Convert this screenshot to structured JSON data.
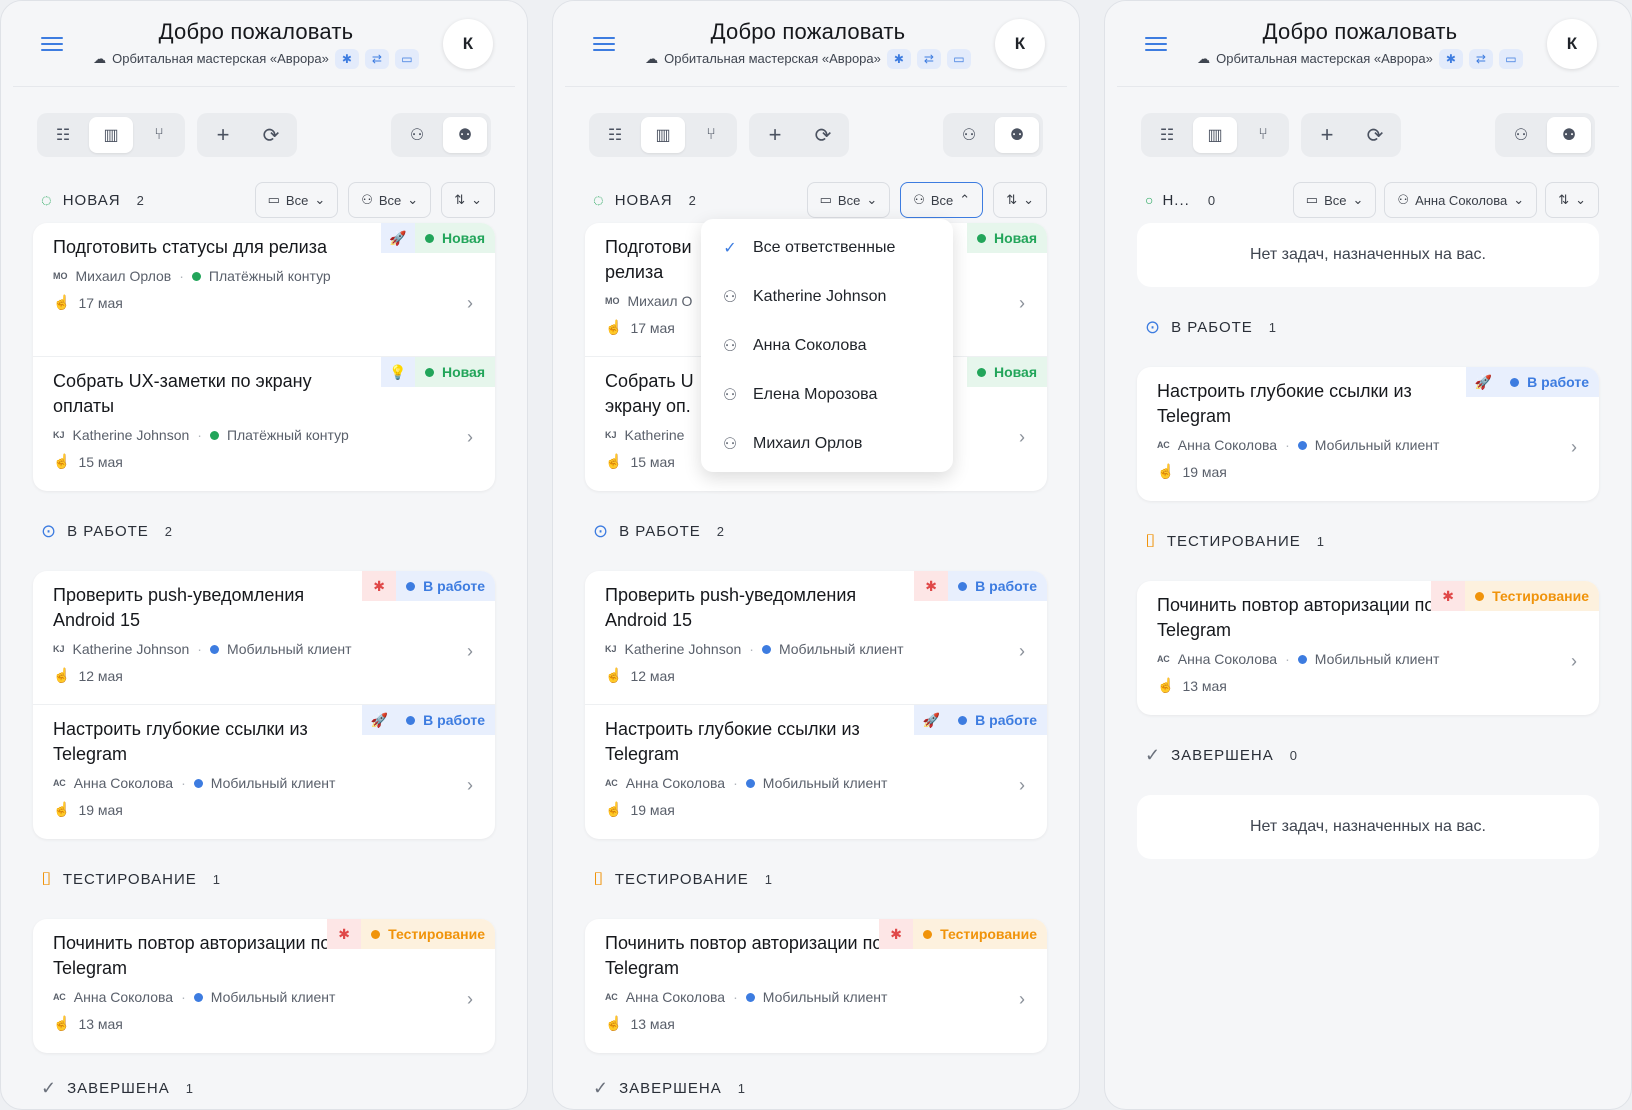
{
  "header": {
    "title": "Добро пожаловать",
    "workspace": "Орбитальная мастерская «Аврора»",
    "avatar": "К"
  },
  "filters": {
    "scope_all": "Все",
    "assignee_all": "Все",
    "assignee_selected": "Анна Соколова"
  },
  "statuses": {
    "new": "НОВАЯ",
    "new_short": "Н...",
    "in_progress": "В РАБОТЕ",
    "testing": "ТЕСТИРОВАНИЕ",
    "done": "ЗАВЕРШЕНА"
  },
  "counts": {
    "all": {
      "new": "2",
      "in_progress": "2",
      "testing": "1",
      "done": "1"
    },
    "mine": {
      "new": "0",
      "in_progress": "1",
      "testing": "1",
      "done": "0"
    }
  },
  "badges": {
    "new": "Новая",
    "in_progress": "В работе",
    "testing": "Тестирование"
  },
  "tasks": [
    {
      "title": "Подготовить статусы для релиза",
      "initials": "МО",
      "assignee": "Михаил Орлов",
      "project": "Платёжный контур",
      "date": "17 мая"
    },
    {
      "title": "Собрать UX-заметки по экрану оплаты",
      "initials": "KJ",
      "assignee": "Katherine Johnson",
      "project": "Платёжный контур",
      "date": "15 мая"
    },
    {
      "title": "Проверить push-уведомления Android 15",
      "initials": "KJ",
      "assignee": "Katherine Johnson",
      "project": "Мобильный клиент",
      "date": "12 мая"
    },
    {
      "title": "Настроить глубокие ссылки из Telegram",
      "initials": "АС",
      "assignee": "Анна Соколова",
      "project": "Мобильный клиент",
      "date": "19 мая"
    },
    {
      "title": "Починить повтор авторизации по Telegram",
      "initials": "АС",
      "assignee": "Анна Соколова",
      "project": "Мобильный клиент",
      "date": "13 мая"
    }
  ],
  "dropdown": {
    "items": [
      "Все ответственные",
      "Katherine Johnson",
      "Анна Соколова",
      "Елена Морозова",
      "Михаил Орлов"
    ]
  },
  "truncated": {
    "t0": "Подготови",
    "t0b": "релиза",
    "m0": "Михаил О",
    "t1": "Собрать U",
    "t1b": "экрану оп.",
    "m1": "Katherine"
  },
  "empty_text": "Нет задач, назначенных на вас.",
  "colors": {
    "accent": "#3d7ce0",
    "new": "#22a55a",
    "in_progress": "#3d7ce0",
    "testing": "#f0930a",
    "bug": "#e04848"
  },
  "icons": {
    "list": "list-icon",
    "kanban": "kanban-icon",
    "branch": "branch-icon",
    "add": "plus-icon",
    "refresh": "refresh-icon",
    "me": "user-icon",
    "team": "users-icon"
  }
}
